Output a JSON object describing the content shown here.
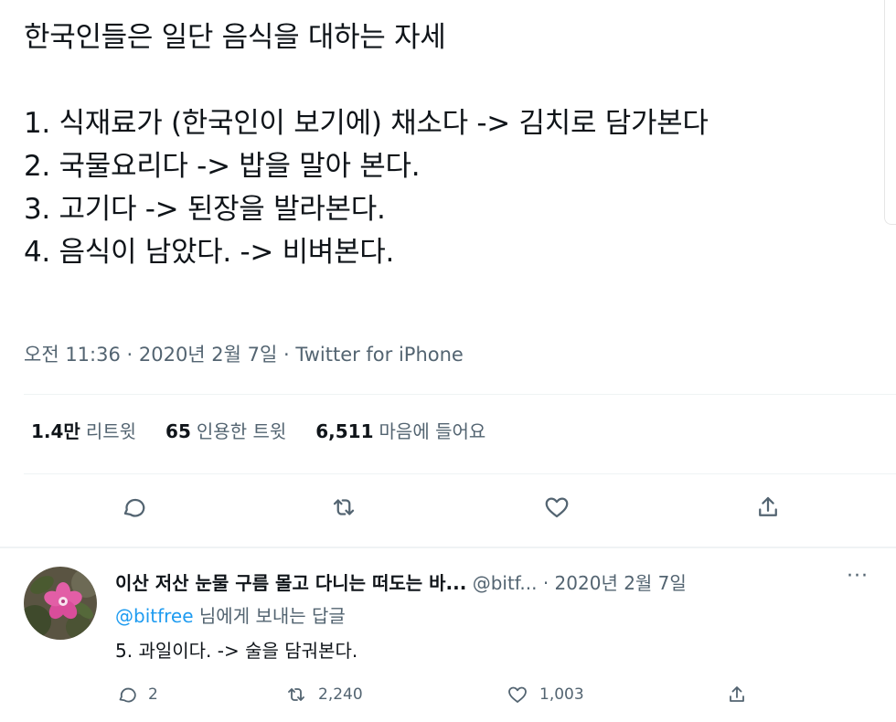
{
  "tweet": {
    "lines": [
      "한국인들은 일단 음식을 대하는 자세",
      "",
      "1. 식재료가 (한국인이 보기에) 채소다 -> 김치로 담가본다",
      "2. 국물요리다 -> 밥을 말아 본다.",
      "3. 고기다 -> 된장을 발라본다.",
      "4. 음식이 남았다. -> 비벼본다."
    ],
    "meta": "오전 11:36 · 2020년 2월 7일 · Twitter for iPhone"
  },
  "stats": {
    "retweets_count": "1.4만",
    "retweets_label": "리트윗",
    "quotes_count": "65",
    "quotes_label": "인용한 트윗",
    "likes_count": "6,511",
    "likes_label": "마음에 들어요"
  },
  "actions": {
    "icons": [
      "reply-icon",
      "retweet-icon",
      "like-icon",
      "share-icon"
    ]
  },
  "reply": {
    "name": "이산 저산 눈물 구름 몰고 다니는 떠도는 바...",
    "handle": "@bitf...",
    "date": "· 2020년 2월 7일",
    "more": "···",
    "replying_mention": "@bitfree",
    "replying_suffix": " 님에게 보내는 답글",
    "text": "5. 과일이다. -> 술을 담궈본다.",
    "reply_count": "2",
    "retweet_count": "2,240",
    "like_count": "1,003"
  },
  "colors": {
    "text": "#0f1419",
    "secondary": "#536471",
    "link": "#1d9bf0",
    "divider": "#eff3f4"
  }
}
